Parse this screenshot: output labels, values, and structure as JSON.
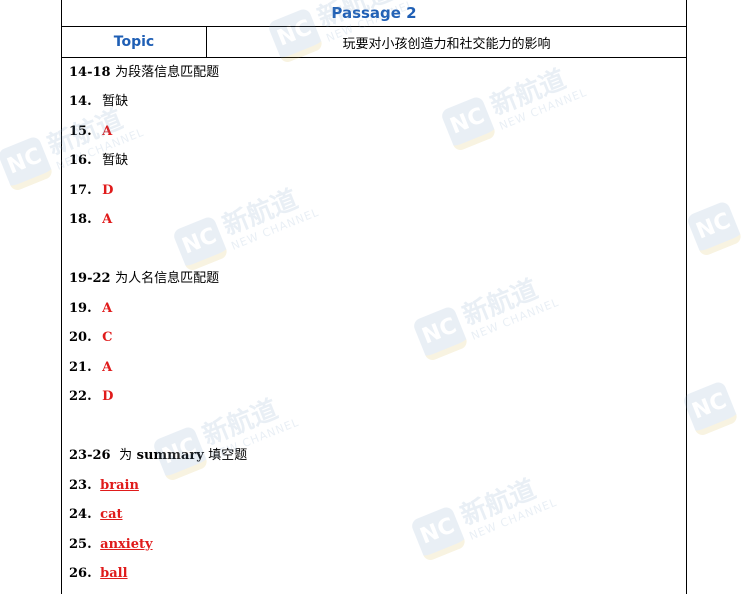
{
  "header": {
    "passage_title": "Passage 2",
    "topic_label": "Topic",
    "topic_value": "玩要对小孩创造力和社交能力的影响"
  },
  "sections": [
    {
      "heading_num": "14-18",
      "heading_text": "为段落信息匹配题",
      "items": [
        {
          "num": "14.",
          "answer": "暂缺",
          "type": "missing"
        },
        {
          "num": "15.",
          "answer": "A",
          "type": "letter"
        },
        {
          "num": "16.",
          "answer": "暂缺",
          "type": "missing"
        },
        {
          "num": "17.",
          "answer": "D",
          "type": "letter"
        },
        {
          "num": "18.",
          "answer": "A",
          "type": "letter"
        }
      ]
    },
    {
      "heading_num": "19-22",
      "heading_text": "为人名信息匹配题",
      "items": [
        {
          "num": "19.",
          "answer": "A",
          "type": "letter"
        },
        {
          "num": "20.",
          "answer": "C",
          "type": "letter"
        },
        {
          "num": "21.",
          "answer": "A",
          "type": "letter"
        },
        {
          "num": "22.",
          "answer": "D",
          "type": "letter"
        }
      ]
    },
    {
      "heading_num": "23-26",
      "heading_text_pre": "为",
      "heading_text_mid": "summary",
      "heading_text_post": "填空题",
      "items": [
        {
          "num": "23.",
          "answer": "brain",
          "type": "word"
        },
        {
          "num": "24.",
          "answer": "cat",
          "type": "word"
        },
        {
          "num": "25.",
          "answer": "anxiety",
          "type": "word"
        },
        {
          "num": "26.",
          "answer": "ball",
          "type": "word"
        }
      ]
    }
  ],
  "watermark": {
    "logo": "NC",
    "cn": "新航道",
    "en": "NEW CHANNEL"
  }
}
